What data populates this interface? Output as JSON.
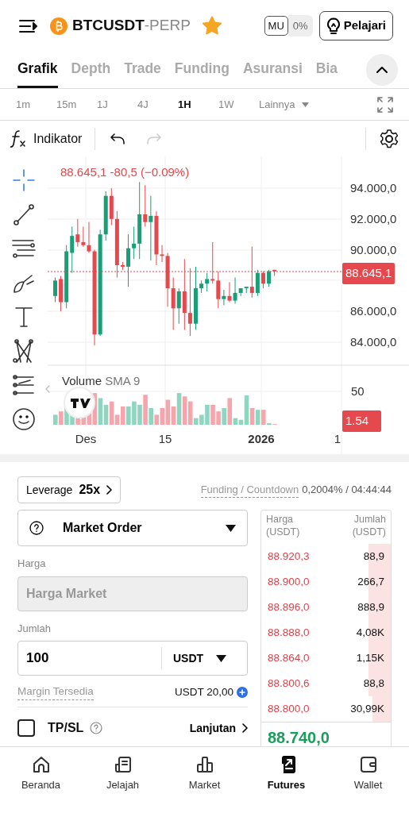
{
  "header": {
    "symbol": "BTCUSDT",
    "suffix": "-PERP",
    "favorite": true,
    "mode_badge": "MU",
    "mode_value": "0%",
    "learn_button": "Pelajari"
  },
  "tabs": [
    {
      "label": "Grafik",
      "selected": true
    },
    {
      "label": "Depth",
      "selected": false
    },
    {
      "label": "Trade",
      "selected": false
    },
    {
      "label": "Funding",
      "selected": false
    },
    {
      "label": "Asuransi",
      "selected": false
    },
    {
      "label": "Bia",
      "selected": false
    }
  ],
  "intervals": [
    {
      "label": "1m",
      "selected": false
    },
    {
      "label": "15m",
      "selected": false
    },
    {
      "label": "1J",
      "selected": false
    },
    {
      "label": "4J",
      "selected": false
    },
    {
      "label": "1H",
      "selected": true
    },
    {
      "label": "1W",
      "selected": false
    }
  ],
  "more_intervals": "Lainnya",
  "chart_toolbar": {
    "indicator_label": "Indikator",
    "redo_disabled": true
  },
  "drawing_tools": [
    {
      "kind": "crosshair",
      "selected": true
    },
    {
      "kind": "trend-line",
      "selected": false
    },
    {
      "kind": "parallel-lines",
      "selected": false
    },
    {
      "kind": "brush",
      "selected": false
    },
    {
      "kind": "text",
      "selected": false
    },
    {
      "kind": "pattern",
      "selected": false
    },
    {
      "kind": "forecast",
      "selected": false
    },
    {
      "kind": "emoji",
      "selected": false
    }
  ],
  "chart": {
    "legend": "88.645,1  -80,5 (−0.09%)",
    "price_ticks": [
      {
        "label": "94.000,0",
        "kind": "p94"
      },
      {
        "label": "92.000,0",
        "kind": "p92"
      },
      {
        "label": "90.000,0",
        "kind": "p90"
      },
      {
        "label": "86.000,0",
        "kind": "p86"
      },
      {
        "label": "84.000,0",
        "kind": "p84"
      }
    ],
    "last_price": "88.645,1",
    "volume_label": "Volume",
    "volume_sma": "SMA 9",
    "volume_tick": "50",
    "volume_last": "1.54",
    "x_labels": [
      {
        "label": "Des",
        "bold": false
      },
      {
        "label": "15",
        "bold": false
      },
      {
        "label": "2026",
        "bold": true
      },
      {
        "label": "1",
        "bold": false
      }
    ]
  },
  "order_form": {
    "leverage_label": "Leverage",
    "leverage_value": "25x",
    "funding_label": "Funding / Countdown",
    "funding_value": "0,2004% / 04:44:44",
    "order_type": "Market Order",
    "price": {
      "label": "Harga",
      "placeholder": "Harga Market",
      "disabled": true
    },
    "amount": {
      "label": "Jumlah",
      "value": "100",
      "unit": "USDT"
    },
    "margin": {
      "label": "Margin Tersedia",
      "value": "USDT 20,00"
    },
    "tpsl": {
      "label": "TP/SL",
      "checked": false
    },
    "advanced": "Lanjutan"
  },
  "orderbook": {
    "columns": [
      "Harga (USDT)",
      "Jumlah (USDT)"
    ],
    "asks": [
      {
        "price": "88.920,3",
        "amount": "88,9"
      },
      {
        "price": "88.900,0",
        "amount": "266,7"
      },
      {
        "price": "88.896,0",
        "amount": "888,9"
      },
      {
        "price": "88.888,0",
        "amount": "4,08K"
      },
      {
        "price": "88.864,0",
        "amount": "1,15K"
      },
      {
        "price": "88.800,6",
        "amount": "88,8"
      },
      {
        "price": "88.800,0",
        "amount": "30,99K"
      }
    ],
    "last_price": "88.740,0"
  },
  "bottom_nav": [
    {
      "kind": "home",
      "label": "Beranda",
      "selected": false
    },
    {
      "kind": "explore",
      "label": "Jelajah",
      "selected": false
    },
    {
      "kind": "market",
      "label": "Market",
      "selected": false
    },
    {
      "kind": "futures",
      "label": "Futures",
      "selected": true
    },
    {
      "kind": "wallet",
      "label": "Wallet",
      "selected": false
    }
  ]
}
